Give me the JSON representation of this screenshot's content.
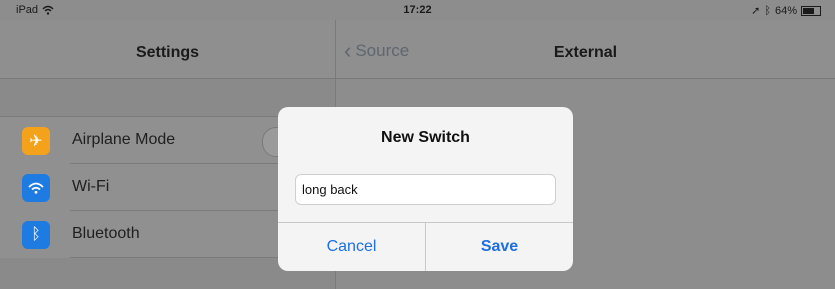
{
  "status_bar": {
    "device": "iPad",
    "time": "17:22",
    "battery": "64%"
  },
  "left_pane": {
    "title": "Settings",
    "items": [
      {
        "label": "Airplane Mode",
        "icon": "airplane-icon",
        "icon_color": "#f4a21c"
      },
      {
        "label": "Wi-Fi",
        "icon": "wifi-icon",
        "icon_color": "#1d7be2"
      },
      {
        "label": "Bluetooth",
        "icon": "bluetooth-icon",
        "icon_color": "#1d7be2"
      }
    ]
  },
  "right_pane": {
    "back_label": "Source",
    "title": "External"
  },
  "dialog": {
    "title": "New Switch",
    "input_value": "long back",
    "cancel_label": "Cancel",
    "save_label": "Save"
  },
  "colors": {
    "accent": "#1d6fe3"
  }
}
